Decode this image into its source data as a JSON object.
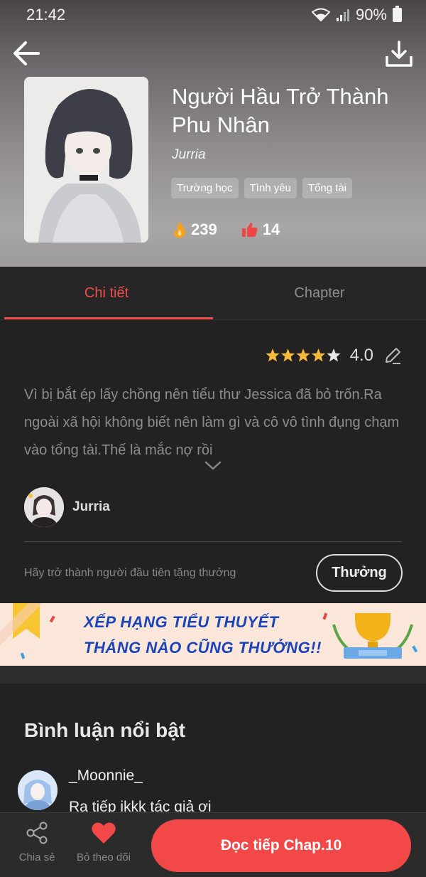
{
  "status_bar": {
    "time": "21:42",
    "battery": "90%"
  },
  "book": {
    "title": "Người Hầu Trở Thành Phu Nhân",
    "author": "Jurria",
    "tags": [
      "Trường học",
      "Tình yêu",
      "Tổng tài"
    ],
    "views": "239",
    "likes": "14"
  },
  "tabs": [
    {
      "label": "Chi tiết",
      "active": true
    },
    {
      "label": "Chapter",
      "active": false
    }
  ],
  "detail": {
    "rating_value": "4.0",
    "stars_filled": 4,
    "stars_total": 5,
    "synopsis": "Vì bị bắt ép lấy chồng nên tiểu thư Jessica đã bỏ trốn.Ra ngoài xã hội không biết nên làm gì và cô vô tình đụng chạm vào tổng tài.Thế là mắc nợ rồi",
    "author_name": "Jurria",
    "reward_prompt": "Hãy trở thành người đầu tiên tặng thưởng",
    "reward_button": "Thưởng"
  },
  "banner": {
    "line1": "XẾP HẠNG TIỂU THUYẾT",
    "line2": "THÁNG NÀO CŨNG THƯỞNG!!"
  },
  "comments": {
    "heading": "Bình luận nổi bật",
    "items": [
      {
        "user": "_Moonnie_",
        "text": "Ra tiếp ikkk tác giả ơi"
      }
    ]
  },
  "bottom_bar": {
    "share_label": "Chia sẻ",
    "follow_label": "Bỏ theo dõi",
    "read_button": "Đọc tiếp Chap.10"
  },
  "colors": {
    "accent": "#f24848",
    "star": "#f6b93b",
    "banner_text": "#1a44b8"
  }
}
